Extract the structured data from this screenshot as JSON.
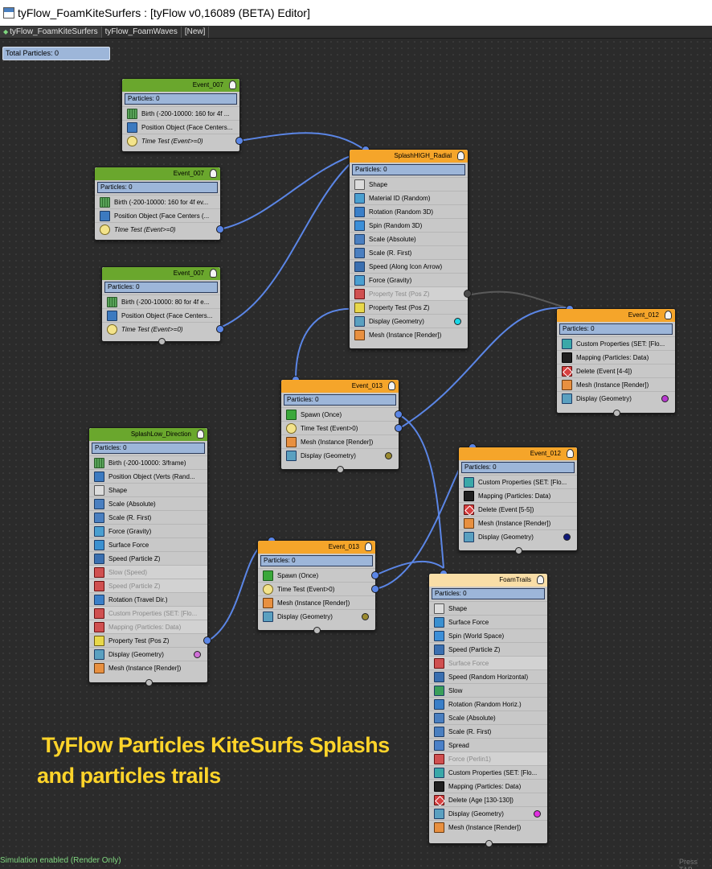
{
  "window": {
    "title": "tyFlow_FoamKiteSurfers : [tyFlow v0,16089 (BETA) Editor]"
  },
  "tabs": [
    {
      "label": "tyFlow_FoamKiteSurfers"
    },
    {
      "label": "tyFlow_FoamWaves"
    },
    {
      "label": "[New]"
    }
  ],
  "total_particles": "Total Particles: 0",
  "nodes": {
    "e007a": {
      "title": "Event_007",
      "particles": "Particles: 0",
      "ops": [
        "Birth (-200-10000: 160 for 4f ...",
        "Position Object (Face Centers...",
        "Time Test (Event>=0)"
      ]
    },
    "e007b": {
      "title": "Event_007",
      "particles": "Particles: 0",
      "ops": [
        "Birth (-200-10000: 160 for 4f ev...",
        "Position Object (Face Centers (...",
        "Time Test (Event>=0)"
      ]
    },
    "e007c": {
      "title": "Event_007",
      "particles": "Particles: 0",
      "ops": [
        "Birth (-200-10000: 80 for 4f e...",
        "Position Object (Face Centers...",
        "Time Test (Event>=0)"
      ]
    },
    "splash_high": {
      "title": "SplashHIGH_Radial",
      "particles": "Particles: 0",
      "ops": [
        "Shape",
        "Material ID (Random)",
        "Rotation (Random 3D)",
        "Spin (Random 3D)",
        "Scale (Absolute)",
        "Scale (R. First)",
        "Speed (Along Icon Arrow)",
        "Force (Gravity)",
        "Property Test (Pos Z)",
        "Property Test (Pos Z)",
        "Display (Geometry)",
        "Mesh (Instance [Render])"
      ]
    },
    "e012a": {
      "title": "Event_012",
      "particles": "Particles: 0",
      "ops": [
        "Custom Properties (SET: [Flo...",
        "Mapping (Particles: Data)",
        "Delete (Event [4-4])",
        "Mesh (Instance [Render])",
        "Display (Geometry)"
      ]
    },
    "e013a": {
      "title": "Event_013",
      "particles": "Particles: 0",
      "ops": [
        "Spawn (Once)",
        "Time Test (Event>0)",
        "Mesh (Instance [Render])",
        "Display (Geometry)"
      ]
    },
    "splash_low": {
      "title": "SplashLow_Direction",
      "particles": "Particles: 0",
      "ops": [
        "Birth (-200-10000: 3/frame)",
        "Position Object (Verts (Rand...",
        "Shape",
        "Scale (Absolute)",
        "Scale (R. First)",
        "Force (Gravity)",
        "Surface Force",
        "Speed (Particle Z)",
        "Slow (Speed)",
        "Speed (Particle Z)",
        "Rotation (Travel Dir.)",
        "Custom Properties (SET: [Flo...",
        "Mapping (Particles: Data)",
        "Property Test (Pos Z)",
        "Display (Geometry)",
        "Mesh (Instance [Render])"
      ]
    },
    "e012b": {
      "title": "Event_012",
      "particles": "Particles: 0",
      "ops": [
        "Custom Properties (SET: [Flo...",
        "Mapping (Particles: Data)",
        "Delete (Event [5-5])",
        "Mesh (Instance [Render])",
        "Display (Geometry)"
      ]
    },
    "e013b": {
      "title": "Event_013",
      "particles": "Particles: 0",
      "ops": [
        "Spawn (Once)",
        "Time Test (Event>0)",
        "Mesh (Instance [Render])",
        "Display (Geometry)"
      ]
    },
    "foam_trails": {
      "title": "FoamTrails",
      "particles": "Particles: 0",
      "ops": [
        "Shape",
        "Surface Force",
        "Spin (World Space)",
        "Speed (Particle Z)",
        "Surface Force",
        "Speed (Random Horizontal)",
        "Slow",
        "Rotation (Random Horiz.)",
        "Scale (Absolute)",
        "Scale (R. First)",
        "Spread",
        "Force (Perlin1)",
        "Custom Properties (SET: [Flo...",
        "Mapping (Particles: Data)",
        "Delete (Age [130-130])",
        "Display (Geometry)",
        "Mesh (Instance [Render])"
      ]
    }
  },
  "colors": {
    "header_green": "#6aa72d",
    "header_orange": "#f5a52a",
    "header_peach": "#f9dea7",
    "wire_blue": "#5b86e6",
    "display_cyan": "#19d6e6",
    "display_olive": "#9a8a30",
    "display_purple": "#b838d0",
    "display_navy": "#101a7a",
    "display_pink": "#d070d8",
    "display_magenta": "#e030e0",
    "caption_yellow": "#ffd42a"
  },
  "caption": {
    "line1": "TyFlow Particles KiteSurfs Splashs",
    "line2": "and particles trails"
  },
  "status": {
    "left": "Simulation enabled (Render Only)",
    "right": "Press TAB"
  }
}
